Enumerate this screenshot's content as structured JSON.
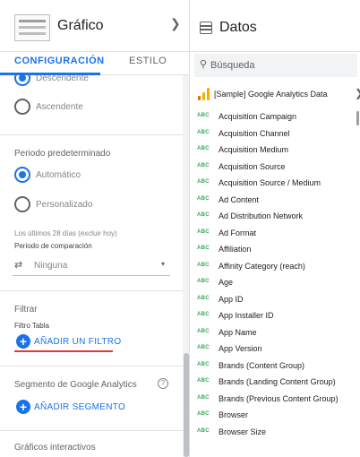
{
  "left_panel": {
    "title": "Gráfico",
    "tabs": [
      "CONFIGURACIÓN",
      "ESTILO"
    ],
    "sort_options": [
      "Descendente",
      "Ascendente"
    ],
    "default_period": {
      "title": "Periodo predeterminado",
      "options": [
        "Automático",
        "Personalizado"
      ],
      "summary": "Los últimos 28 días (excluir hoy)",
      "comparison_label": "Periodo de comparación",
      "comparison_value": "Ninguna"
    },
    "filter": {
      "title": "Filtrar",
      "subtitle": "Filtro Tabla",
      "add_label": "AÑADIR UN FILTRO"
    },
    "segment": {
      "title": "Segmento de Google Analytics",
      "add_label": "AÑADIR SEGMENTO"
    },
    "interactive": {
      "title": "Gráficos interactivos"
    }
  },
  "right_panel": {
    "title": "Datos",
    "search_placeholder": "Búsqueda",
    "data_source": "[Sample] Google Analytics Data",
    "field_type_label": "ABC",
    "fields": [
      "Acquisition Campaign",
      "Acquisition Channel",
      "Acquisition Medium",
      "Acquisition Source",
      "Acquisition Source / Medium",
      "Ad Content",
      "Ad Distribution Network",
      "Ad Format",
      "Affiliation",
      "Affinity Category (reach)",
      "Age",
      "App ID",
      "App Installer ID",
      "App Name",
      "App Version",
      "Brands (Content Group)",
      "Brands (Landing Content Group)",
      "Brands (Previous Content Group)",
      "Browser",
      "Browser Size"
    ]
  },
  "colors": {
    "accent": "#1a73e8",
    "field_type": "#34a853",
    "highlight_underline": "#e53935"
  }
}
